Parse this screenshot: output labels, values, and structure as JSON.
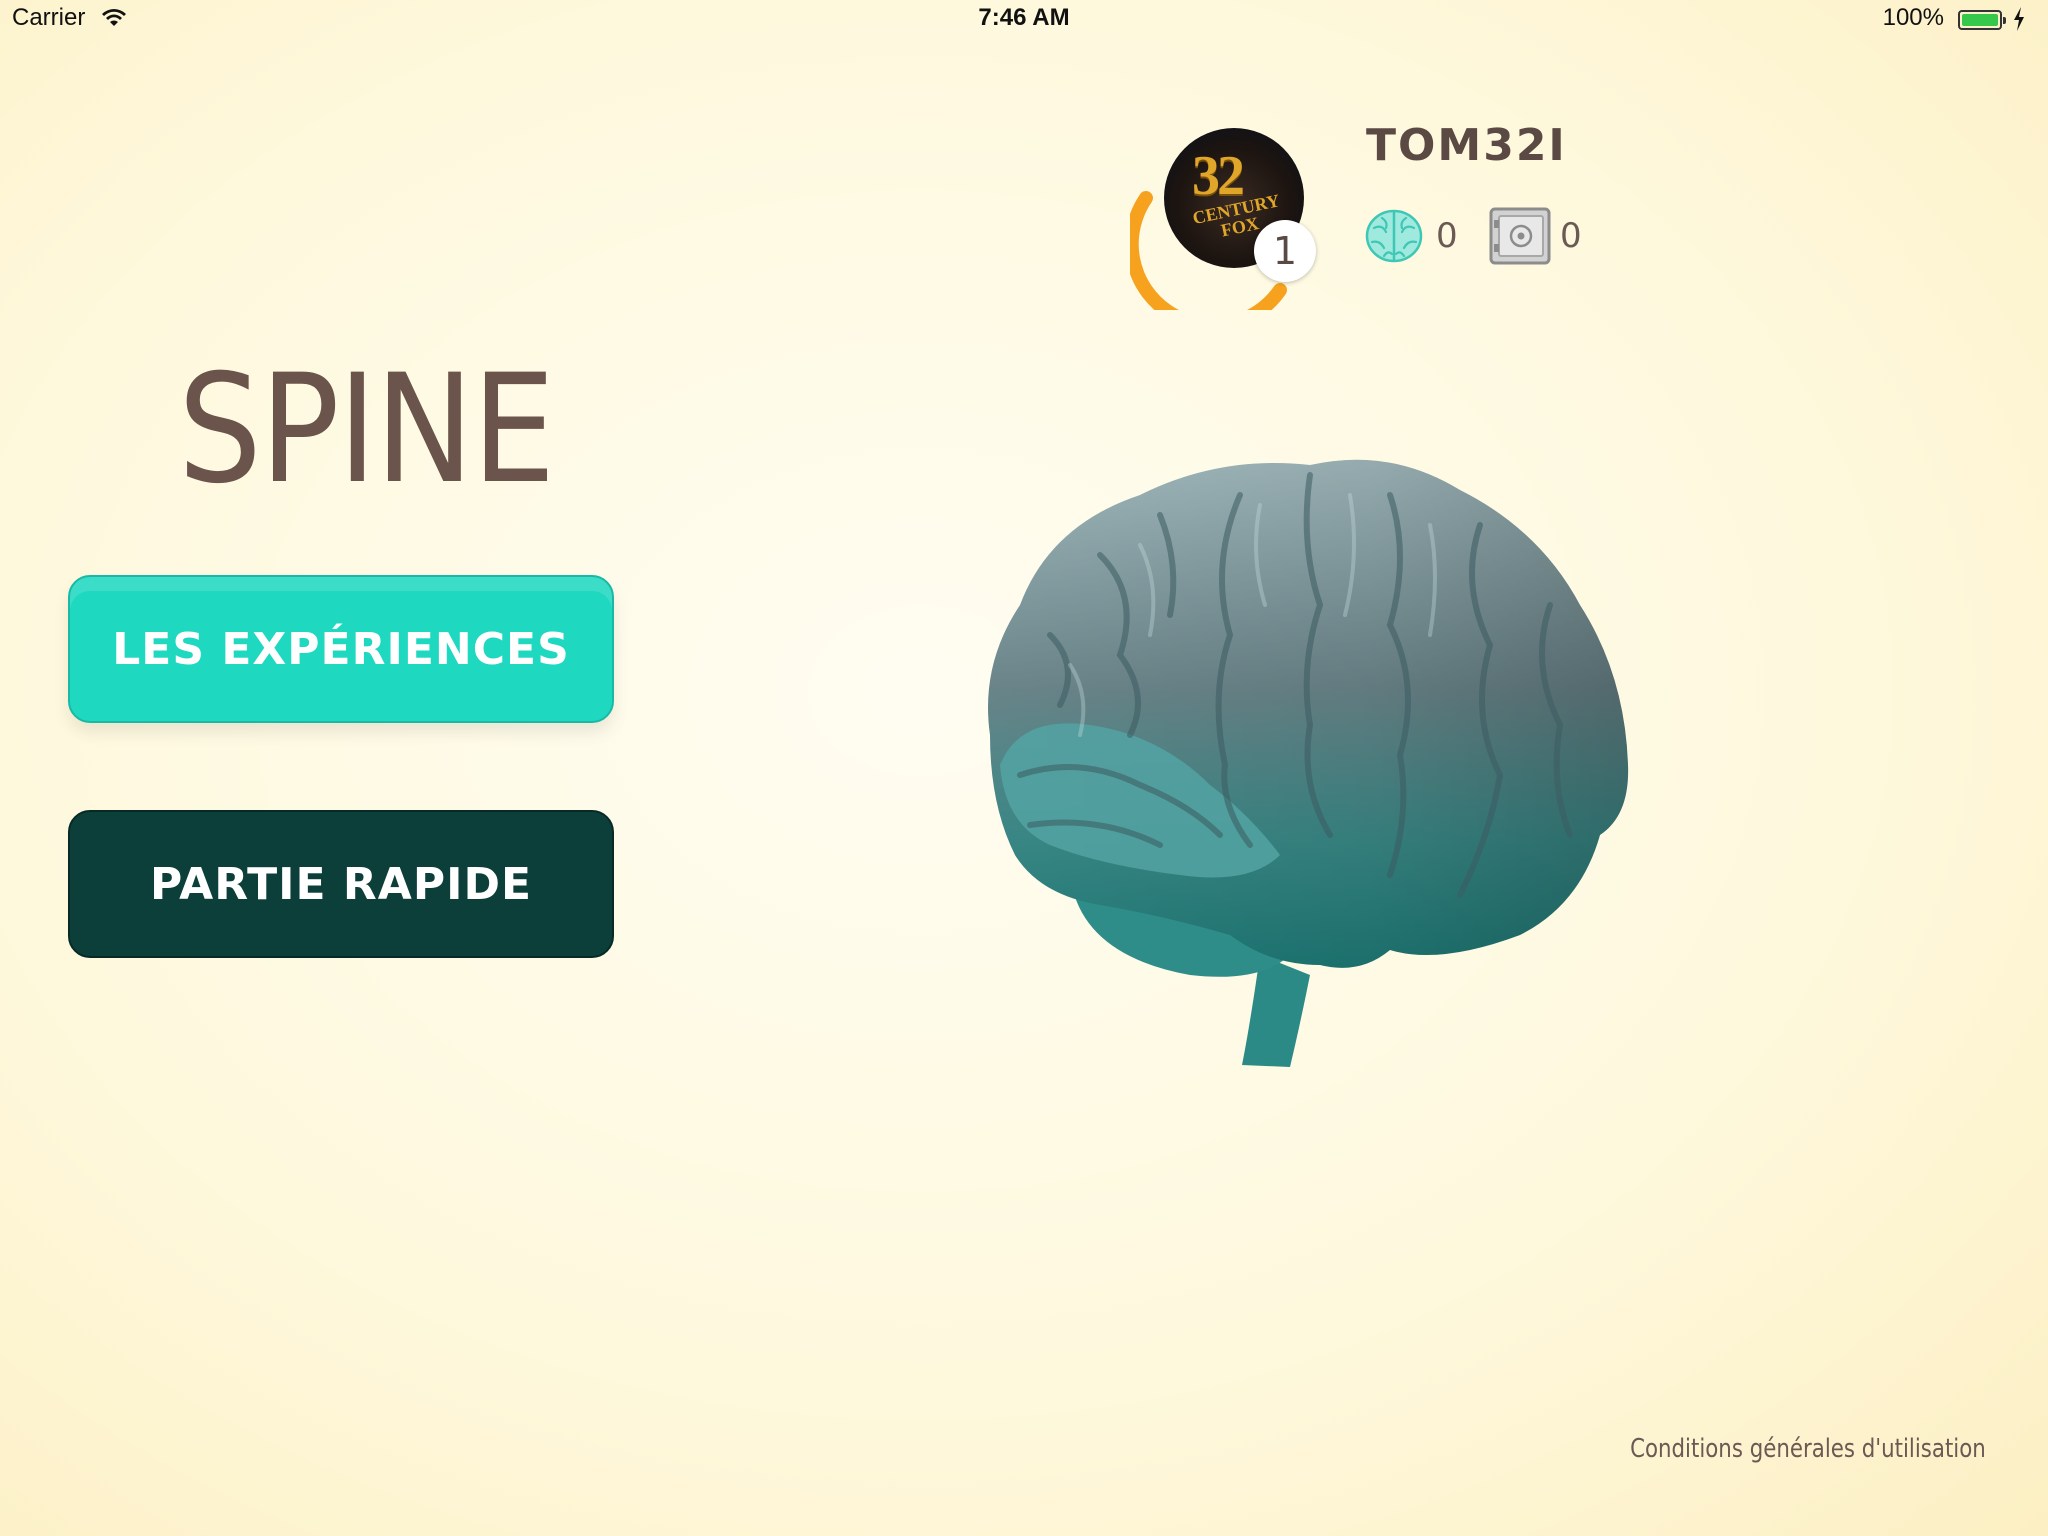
{
  "status_bar": {
    "carrier": "Carrier",
    "time": "7:46 AM",
    "battery_percent": "100%"
  },
  "profile": {
    "username": "TOM32I",
    "level": "1",
    "avatar_logo_number": "32",
    "avatar_logo_text": "CENTURY FOX",
    "brain_count": "0",
    "safe_count": "0"
  },
  "main": {
    "title": "SPINE",
    "experiences_button": "LES EXPÉRIENCES",
    "quick_game_button": "PARTIE RAPIDE"
  },
  "footer": {
    "terms_link": "Conditions générales d'utilisation"
  },
  "colors": {
    "accent_teal": "#1fd8c0",
    "dark_green": "#0c3f39",
    "text_brown": "#5b4a44",
    "xp_orange": "#f6a21f"
  },
  "icons": [
    "wifi-icon",
    "battery-icon",
    "brain-icon",
    "safe-icon",
    "brain-model"
  ]
}
